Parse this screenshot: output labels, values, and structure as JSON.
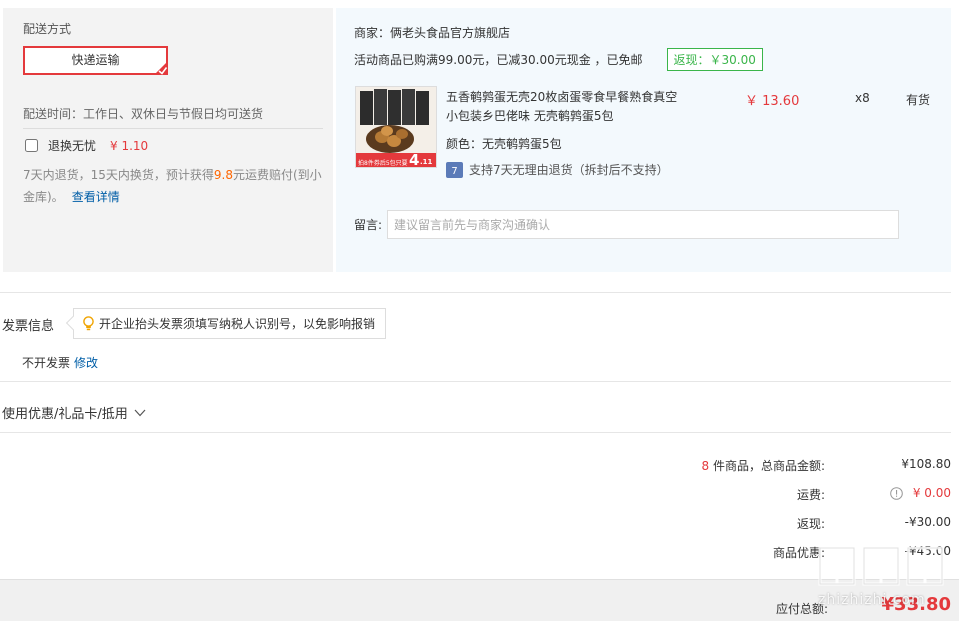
{
  "shipping": {
    "title": "配送方式",
    "method_label": "快递运输",
    "time_text": "配送时间：工作日、双休日与节假日均可送货",
    "return_label": "退换无忧",
    "return_price": "¥ 1.10",
    "return_desc_prefix": "7天内退货，15天内换货，预计获得",
    "return_desc_amount": "9.8",
    "return_desc_suffix": "元运费赔付(到小金库)。",
    "details_link": "查看详情"
  },
  "store": {
    "name": "商家：俩老头食品官方旗舰店",
    "promo_text": "活动商品已购满99.00元，已减30.00元现金 ，已免邮",
    "rebate_badge": "返现：￥30.00",
    "product": {
      "title": "五香鹌鹑蛋无壳20枚卤蛋零食早餐熟食真空小包装乡巴佬味 无壳鹌鹑蛋5包",
      "color": "颜色：无壳鹌鹑蛋5包",
      "support": "支持7天无理由退货（拆封后不支持）",
      "price": "￥ 13.60",
      "qty": "x8",
      "stock": "有货",
      "image_banner": "拍8件券后5包只要",
      "image_badge_big": "4",
      "image_badge_small": ".11",
      "image_icon": "product-thumbnail"
    },
    "note_label": "留言:",
    "note_placeholder": "建议留言前先与商家沟通确认"
  },
  "invoice": {
    "title": "发票信息",
    "tip": "开企业抬头发票须填写纳税人识别号，以免影响报销",
    "status": "不开发票",
    "edit": "修改"
  },
  "coupon": {
    "label": "使用优惠/礼品卡/抵用"
  },
  "summary": {
    "count": "8",
    "count_suffix": " 件商品，总商品金额:",
    "goods_total": "¥108.80",
    "shipping_label": "运费:",
    "shipping_value": "¥ 0.00",
    "rebate_label": "返现:",
    "rebate_value": "-¥30.00",
    "discount_label": "商品优惠:",
    "discount_value": "-¥45.00",
    "total_label": "应付总额:",
    "total_value": "¥33.80"
  },
  "watermark": "zhizhizhi.com",
  "colors": {
    "accent_red": "#e4393c",
    "link_blue": "#005ea7",
    "rebate_green": "#3ab54a",
    "orange": "#ff6600"
  }
}
